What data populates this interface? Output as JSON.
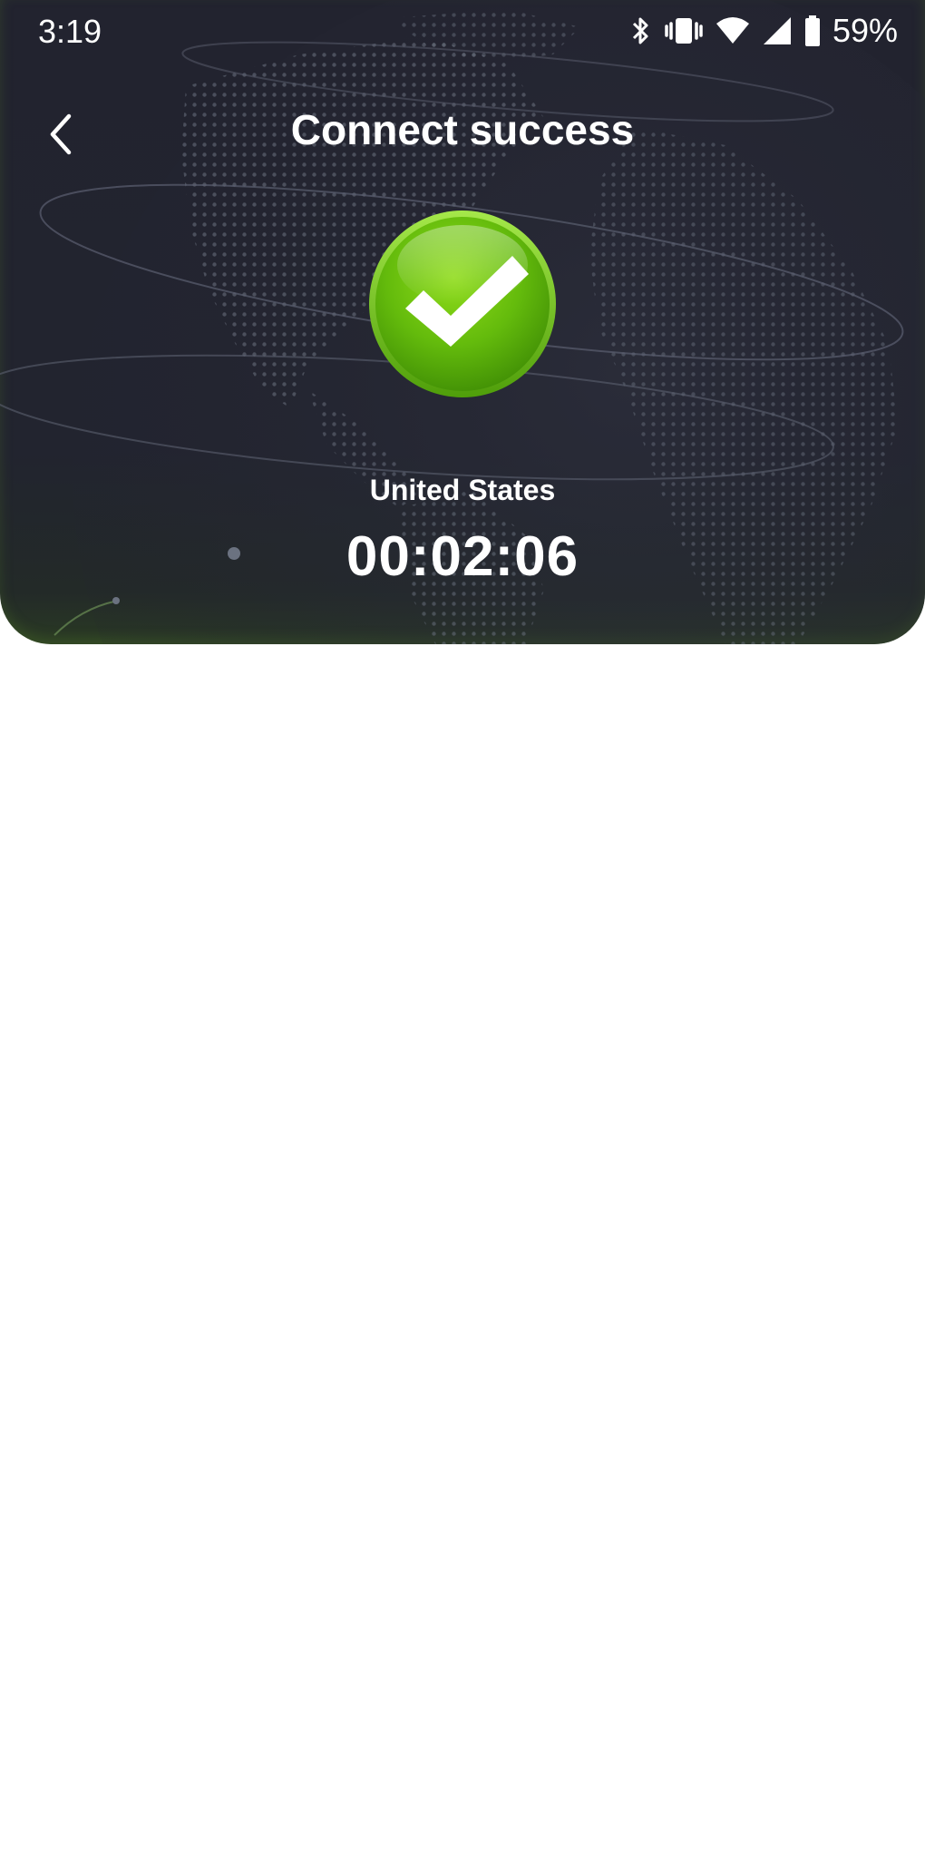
{
  "status_bar": {
    "time": "3:19",
    "battery_percent": "59%",
    "icons": [
      "bluetooth-icon",
      "vibrate-icon",
      "wifi-icon",
      "cell-signal-icon",
      "battery-icon"
    ]
  },
  "header": {
    "back_icon": "chevron-left-icon",
    "title": "Connect success"
  },
  "connection": {
    "status_icon": "checkmark-icon",
    "location": "United States",
    "duration": "00:02:06"
  },
  "colors": {
    "hero_background": "#22232f",
    "success_green": "#6cc00e",
    "text": "#ffffff",
    "page_background": "#ffffff"
  }
}
